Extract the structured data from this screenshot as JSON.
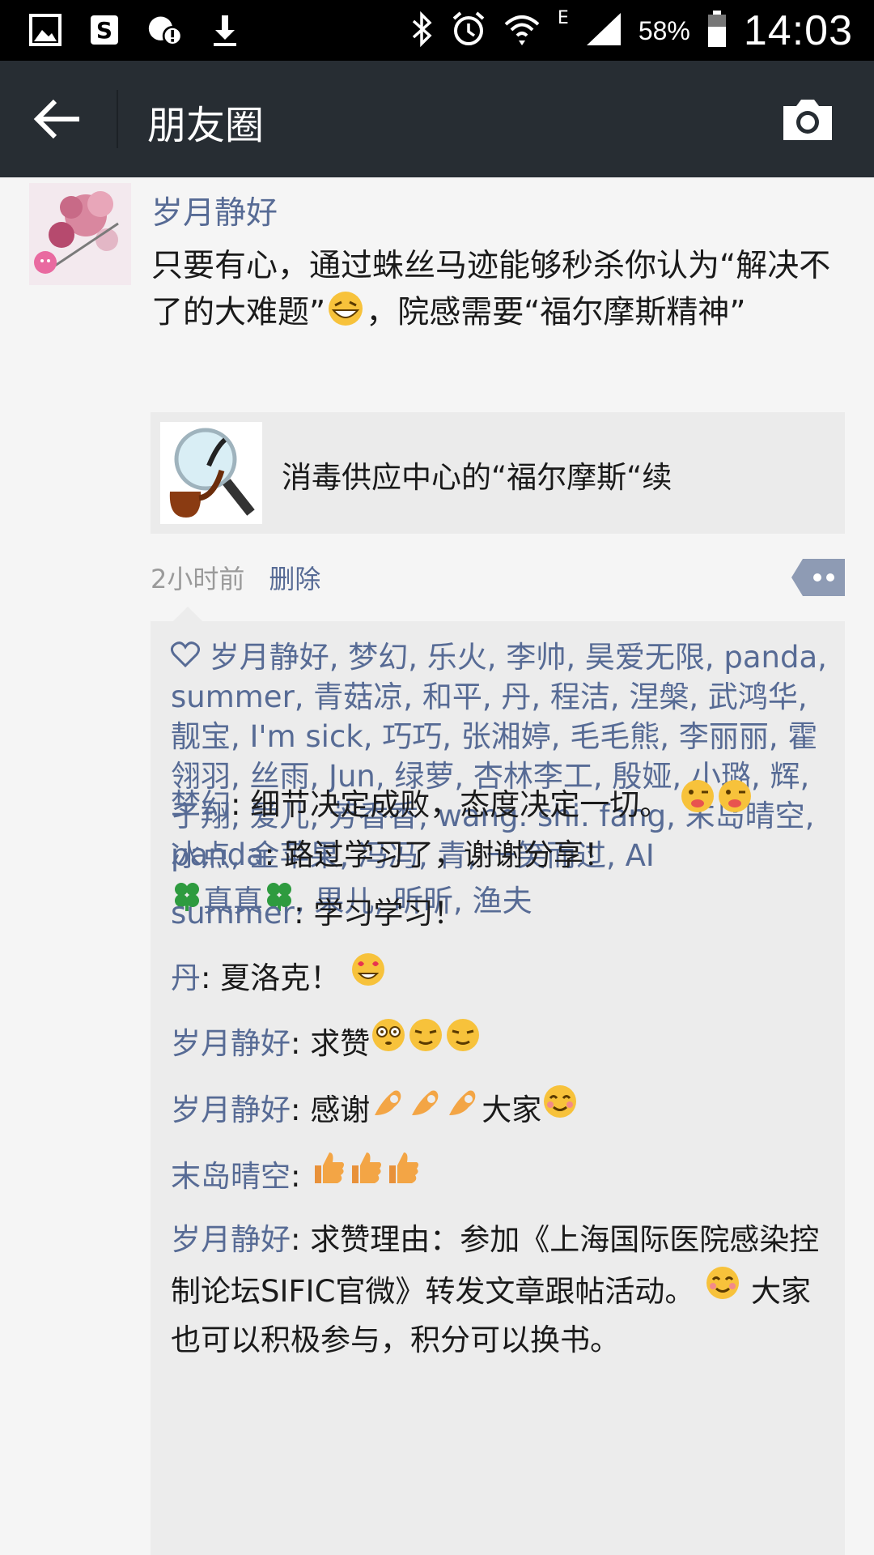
{
  "status_bar": {
    "battery_percent": "58%",
    "time": "14:03",
    "network_type": "E",
    "left_icons": [
      "gallery-icon",
      "s-app-icon",
      "warning-icon",
      "download-icon"
    ],
    "right_icons": [
      "bluetooth-icon",
      "alarm-icon",
      "wifi-icon",
      "signal-icon",
      "battery-icon"
    ]
  },
  "titlebar": {
    "title": "朋友圈"
  },
  "post": {
    "author": "岁月静好",
    "text_part1": "只要有心，通过蛛丝马迹能够秒杀你认为“解决不了的大难题”",
    "text_part2": "，院感需要“福尔摩斯精神”",
    "link_title": "消毒供应中心的“福尔摩斯“续",
    "time": "2小时前",
    "delete_label": "删除"
  },
  "likes": {
    "names": "岁月静好, 梦幻, 乐火, 李帅, 昊爱无限, panda, summer, 青菇凉, 和平, 丹, 程洁, 涅槃, 武鸿华, 靓宝, I'm sick, 巧巧, 张湘婷, 毛毛熊, 李丽丽, 霍翎羽, 丝雨, Jun, 绿萝, 杏林李工, 殷娅, 小璐, 辉, 于翔, 爱儿, 芳香香, wang. shi. fang, 末岛晴空, 冰点, 金苹果, 冯冯, 青, 一笑而过, AI",
    "last_name_core": "真真",
    "last_rest": ", 果儿, 昕昕, 渔夫"
  },
  "comments": [
    {
      "name": "梦幻",
      "text": ": 细节决定成败，态度决定一切。"
    },
    {
      "name": "panda",
      "text": ": 路过学习了，谢谢分享！"
    },
    {
      "name": "summer",
      "text": ": 学习学习！"
    },
    {
      "name": "丹",
      "text": ": 夏洛克！"
    },
    {
      "name": "岁月静好",
      "text": ": 求赞"
    },
    {
      "name": "岁月静好",
      "text": ": 感谢",
      "text_after": "大家"
    },
    {
      "name": "末岛晴空",
      "text": ": "
    },
    {
      "name": "岁月静好",
      "text": ": 求赞理由：参加《上海国际医院感染控制论坛SIFIC官微》转发文章跟帖活动。",
      "text_after": "大家也可以积极参与，积分可以换书。"
    }
  ],
  "colors": {
    "link_blue": "#576b95",
    "titlebar_bg": "#272d33",
    "comment_bg": "#ececec"
  }
}
